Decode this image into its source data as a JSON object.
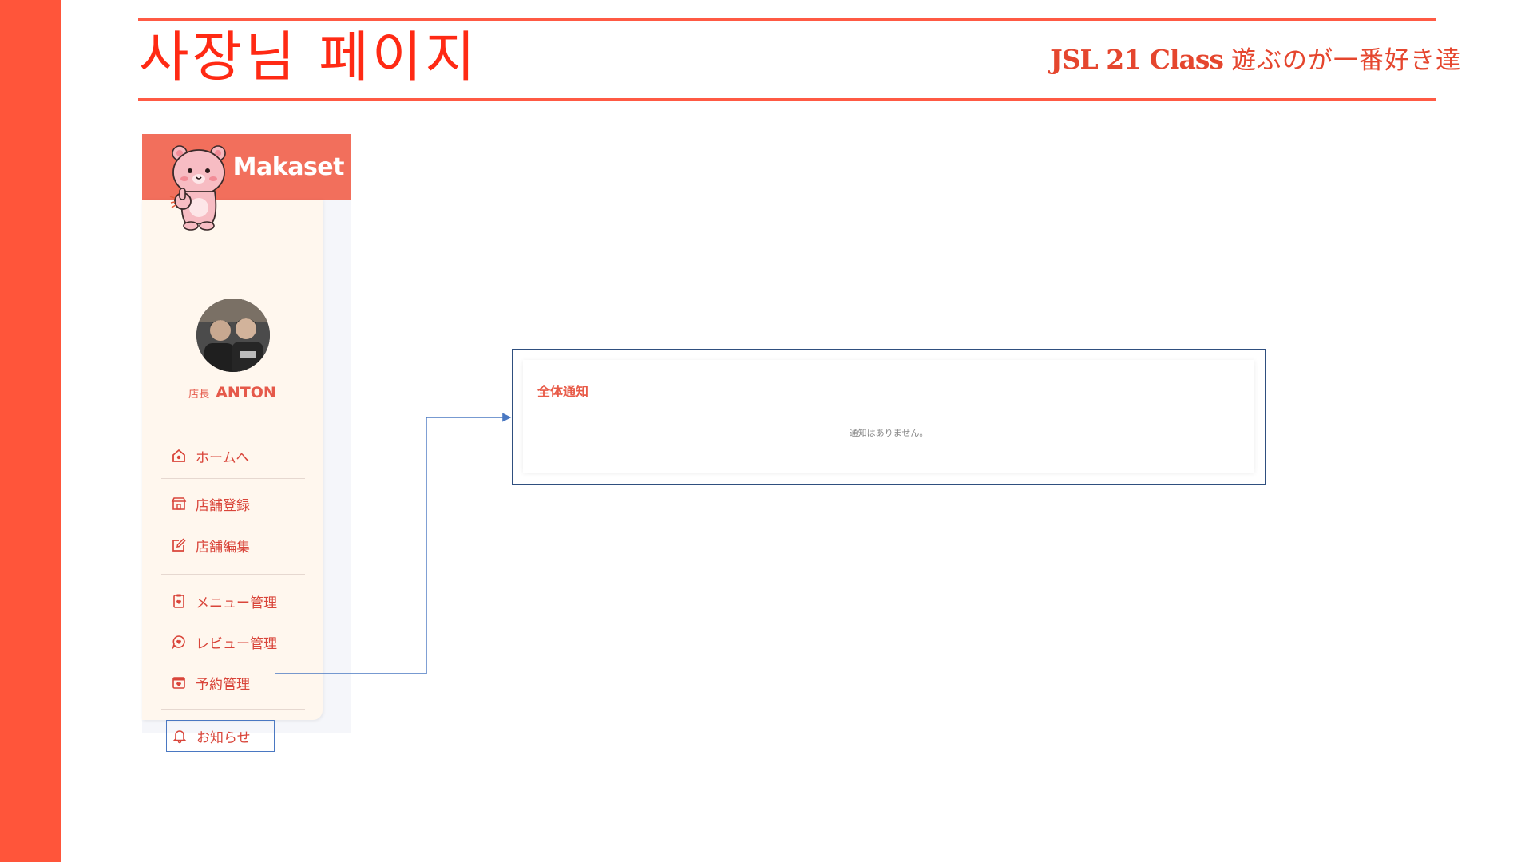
{
  "slide": {
    "title": "사장님 페이지",
    "brand": "JSL 21 Class",
    "tagline": "遊ぶのが一番好き達"
  },
  "colors": {
    "accent_bar": "#ff553a",
    "title": "#ff2a14",
    "sidebar_header": "#f26f5c",
    "sidebar_panel": "#fff7ee",
    "nav_text": "#d9453a",
    "annotation_line": "#4a78c2"
  },
  "sidebar": {
    "app_name": "Makaset",
    "mascot_icon": "thumbs-up-bear-icon",
    "owner_role": "店長",
    "owner_name": "ANTON",
    "nav_groups": [
      [
        {
          "label": "ホームへ",
          "icon": "home-icon"
        }
      ],
      [
        {
          "label": "店舗登録",
          "icon": "store-icon"
        },
        {
          "label": "店舗編集",
          "icon": "edit-icon"
        }
      ],
      [
        {
          "label": "メニュー管理",
          "icon": "menu-clipboard-icon"
        },
        {
          "label": "レビュー管理",
          "icon": "review-chat-icon"
        },
        {
          "label": "予約管理",
          "icon": "calendar-icon"
        }
      ],
      [
        {
          "label": "お知らせ",
          "icon": "bell-icon",
          "highlighted": true
        }
      ]
    ]
  },
  "notice": {
    "title": "全体通知",
    "empty_message": "通知はありません。"
  }
}
